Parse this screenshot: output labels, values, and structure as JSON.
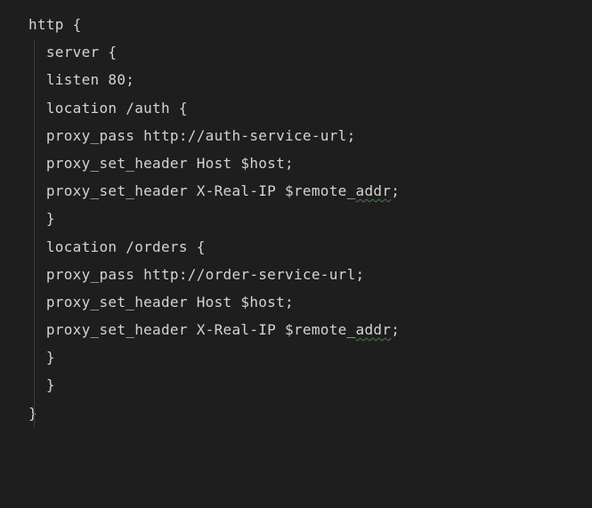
{
  "code": {
    "l1": "http {",
    "l2": "  server {",
    "l3": "  listen 80;",
    "l4": "",
    "l5": "  location /auth {",
    "l6": "  proxy_pass http://auth-service-url;",
    "l7": "  proxy_set_header Host $host;",
    "l8_a": "  proxy_set_header X-Real-IP $remote_",
    "l8_u": "addr",
    "l8_b": ";",
    "l9": "  }",
    "l10": "",
    "l11": "  location /orders {",
    "l12": "  proxy_pass http://order-service-url;",
    "l13": "  proxy_set_header Host $host;",
    "l14_a": "  proxy_set_header X-Real-IP $remote_",
    "l14_u": "addr",
    "l14_b": ";",
    "l15": "  }",
    "l16": "  }",
    "l17": "}"
  }
}
